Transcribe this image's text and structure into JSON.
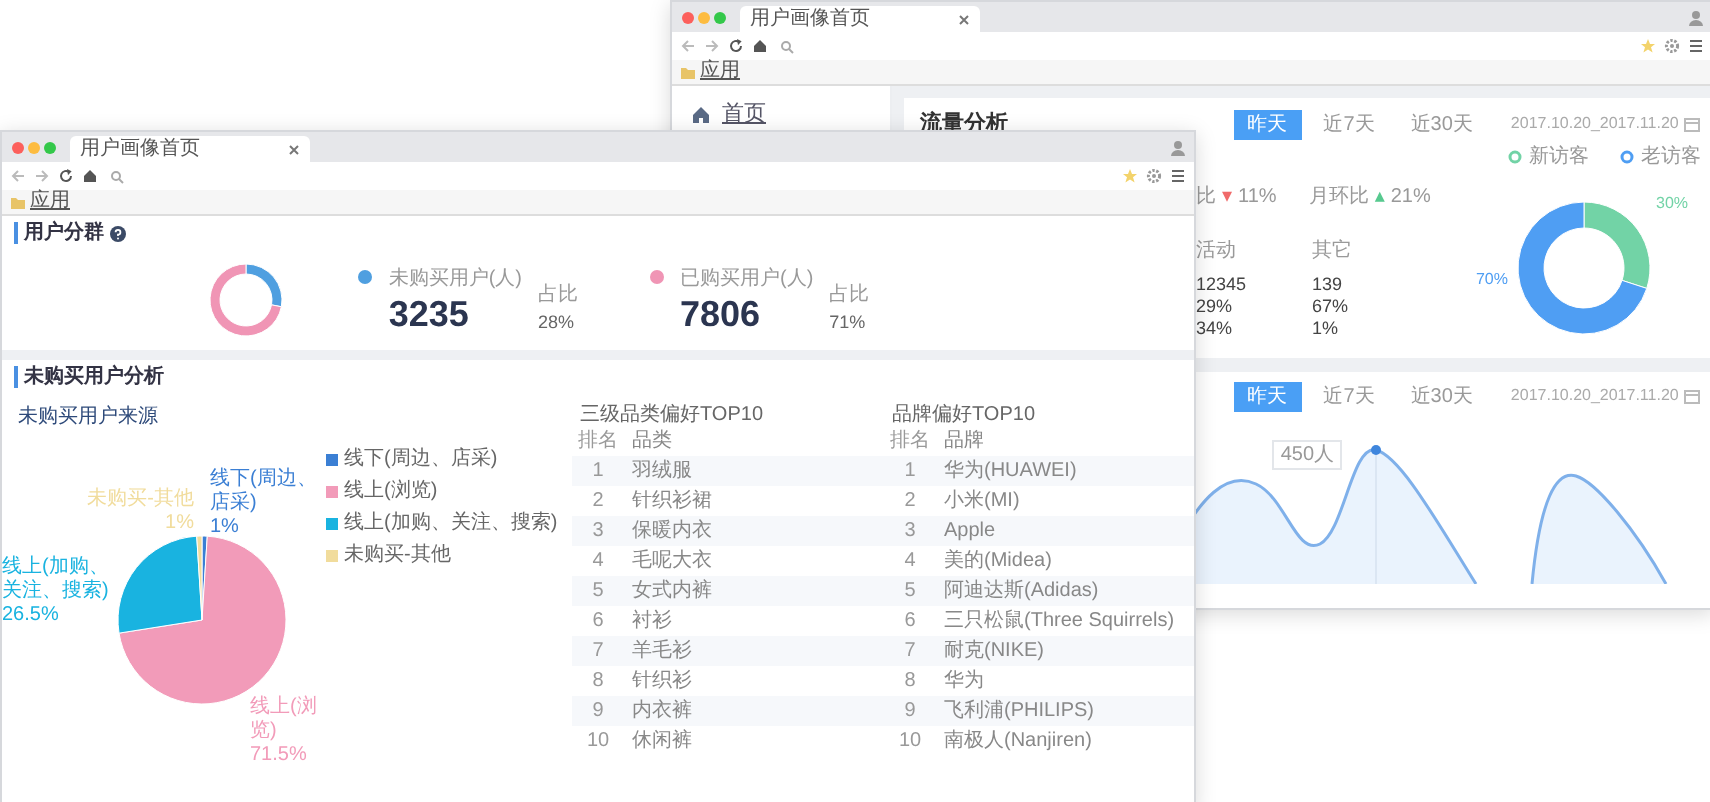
{
  "back_window": {
    "tab_title": "用户画像首页",
    "bookmark": "应用",
    "sidebar": {
      "items": [
        {
          "label": "首页"
        }
      ]
    },
    "traffic": {
      "title": "流量分析",
      "ranges": [
        {
          "label": "昨天",
          "selected": true
        },
        {
          "label": "近7天",
          "selected": false
        },
        {
          "label": "近30天",
          "selected": false
        }
      ],
      "date_range": "2017.10.20_2017.11.20",
      "comparisons": [
        {
          "label": "比",
          "arrow": "▾",
          "value": "11%",
          "color": "#f06a6a"
        },
        {
          "label": "月环比",
          "arrow": "▴",
          "value": "21%",
          "color": "#57c98f"
        }
      ],
      "table": {
        "columns": [
          "活动",
          "其它"
        ],
        "rows": [
          [
            "12345",
            "139"
          ],
          [
            "29%",
            "67%"
          ],
          [
            "34%",
            "1%"
          ]
        ]
      },
      "legend": [
        {
          "label": "新访客",
          "color": "#72d3a6"
        },
        {
          "label": "老访客",
          "color": "#4f9ef3"
        }
      ],
      "chart_data": {
        "type": "donut",
        "values": [
          30,
          70
        ],
        "value_labels": [
          "30%",
          "70%"
        ]
      }
    },
    "trend": {
      "ranges": [
        {
          "label": "昨天",
          "selected": true
        },
        {
          "label": "近7天",
          "selected": false
        },
        {
          "label": "近30天",
          "selected": false
        }
      ],
      "date_range": "2017.10.20_2017.11.20",
      "tooltip": "450人"
    }
  },
  "front_window": {
    "tab_title": "用户画像首页",
    "bookmark": "应用",
    "segments": {
      "title": "用户分群",
      "chart_data": {
        "type": "donut",
        "values": [
          28,
          72
        ]
      },
      "groups": [
        {
          "label": "未购买用户(人)",
          "count": "3235",
          "share_label": "占比",
          "share": "28%",
          "color": "#4f9fe0"
        },
        {
          "label": "已购买用户(人)",
          "count": "7806",
          "share_label": "占比",
          "share": "71%",
          "color": "#f095b5"
        }
      ]
    },
    "analysis": {
      "title": "未购买用户分析",
      "source": {
        "title": "未购买用户来源",
        "chart_data": {
          "type": "pie",
          "categories": [
            "线下(周边、店采)",
            "线上(浏览)",
            "线上(加购、关注、搜索)",
            "未购买-其他"
          ],
          "values": [
            1,
            71.5,
            26.5,
            1
          ],
          "value_labels": [
            "1%",
            "71.5%",
            "26.5%",
            "1%"
          ]
        },
        "legend": [
          {
            "label": "线下(周边、店采)",
            "color": "#3b7fd4"
          },
          {
            "label": "线上(浏览)",
            "color": "#f29bb9"
          },
          {
            "label": "线上(加购、关注、搜索)",
            "color": "#19b3e0"
          },
          {
            "label": "未购买-其他",
            "color": "#f1dc9c"
          }
        ]
      },
      "rankings": [
        {
          "title": "三级品类偏好TOP10",
          "columns": [
            "排名",
            "品类"
          ],
          "rows": [
            [
              "1",
              "羽绒服"
            ],
            [
              "2",
              "针织衫裙"
            ],
            [
              "3",
              "保暖内衣"
            ],
            [
              "4",
              "毛呢大衣"
            ],
            [
              "5",
              "女式内裤"
            ],
            [
              "6",
              "衬衫"
            ],
            [
              "7",
              "羊毛衫"
            ],
            [
              "8",
              "针织衫"
            ],
            [
              "9",
              "内衣裤"
            ],
            [
              "10",
              "休闲裤"
            ]
          ]
        },
        {
          "title": "品牌偏好TOP10",
          "columns": [
            "排名",
            "品牌"
          ],
          "rows": [
            [
              "1",
              "华为(HUAWEI)"
            ],
            [
              "2",
              "小米(MI)"
            ],
            [
              "3",
              "Apple"
            ],
            [
              "4",
              "美的(Midea)"
            ],
            [
              "5",
              "阿迪达斯(Adidas)"
            ],
            [
              "6",
              "三只松鼠(Three Squirrels)"
            ],
            [
              "7",
              "耐克(NIKE)"
            ],
            [
              "8",
              "华为"
            ],
            [
              "9",
              "飞利浦(PHILIPS)"
            ],
            [
              "10",
              "南极人(Nanjiren)"
            ]
          ]
        }
      ]
    }
  }
}
